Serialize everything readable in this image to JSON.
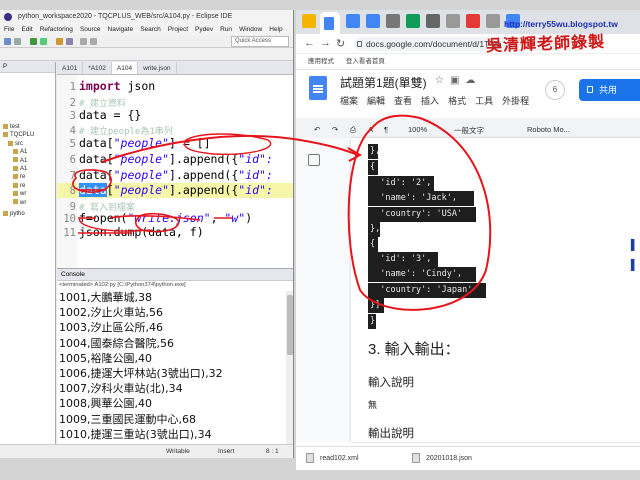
{
  "eclipse": {
    "window_title": "python_workspace2020 - TQCPLUS_WEB/src/A104.py - Eclipse IDE",
    "menu": [
      "File",
      "Edit",
      "Refactoring",
      "Source",
      "Navigate",
      "Search",
      "Project",
      "Pydev",
      "Run",
      "Window",
      "Help"
    ],
    "quick_access": "Quick Access",
    "package_explorer": {
      "tab_label": "P",
      "items": [
        "test",
        "TQCPLU",
        "src",
        "A1",
        "A1",
        "A1",
        "re",
        "re",
        "wr",
        "wr",
        "pytho"
      ]
    },
    "editor_tabs": [
      "A101",
      "*A102",
      "A104",
      "write.json"
    ],
    "code_lines": [
      {
        "n": "1",
        "segments": [
          {
            "t": "import",
            "c": "kw"
          },
          {
            "t": " json",
            "c": ""
          }
        ]
      },
      {
        "n": "2",
        "segments": [
          {
            "t": "# 建立資料",
            "c": "cmt"
          }
        ]
      },
      {
        "n": "3",
        "segments": [
          {
            "t": "data = {}",
            "c": ""
          }
        ]
      },
      {
        "n": "4",
        "segments": [
          {
            "t": "# 建立people為1串列",
            "c": "cmt"
          }
        ]
      },
      {
        "n": "5",
        "segments": [
          {
            "t": "data[",
            "c": ""
          },
          {
            "t": "\"people\"",
            "c": "str"
          },
          {
            "t": "] = []",
            "c": ""
          }
        ]
      },
      {
        "n": "6",
        "segments": [
          {
            "t": "data[",
            "c": ""
          },
          {
            "t": "\"people\"",
            "c": "str"
          },
          {
            "t": "].append({",
            "c": ""
          },
          {
            "t": "\"id\":",
            "c": "str"
          }
        ]
      },
      {
        "n": "7",
        "segments": [
          {
            "t": "data[",
            "c": ""
          },
          {
            "t": "\"people\"",
            "c": "str"
          },
          {
            "t": "].append({",
            "c": ""
          },
          {
            "t": "\"id\":",
            "c": "str"
          }
        ]
      },
      {
        "n": "8",
        "segments": [
          {
            "t": "data",
            "c": "sel"
          },
          {
            "t": "[",
            "c": ""
          },
          {
            "t": "\"people\"",
            "c": "str"
          },
          {
            "t": "].append({",
            "c": ""
          },
          {
            "t": "\"id\":",
            "c": "str"
          }
        ]
      },
      {
        "n": "9",
        "segments": [
          {
            "t": "# 寫入到檔案",
            "c": "cmt"
          }
        ]
      },
      {
        "n": "10",
        "segments": [
          {
            "t": "f=open(",
            "c": ""
          },
          {
            "t": "\"write.json\"",
            "c": "str"
          },
          {
            "t": ", ",
            "c": ""
          },
          {
            "t": "\"w\"",
            "c": "str"
          },
          {
            "t": ")",
            "c": ""
          }
        ]
      },
      {
        "n": "11",
        "segments": [
          {
            "t": "json.dump(data, f)",
            "c": ""
          }
        ]
      }
    ],
    "console": {
      "tab_label": "Console",
      "terminated": "<terminated> A102.py [C:\\Python374\\python.exe]",
      "lines": [
        "1001,大鵬華城,38",
        "1002,汐止火車站,56",
        "1003,汐止區公所,46",
        "1004,國泰綜合醫院,56",
        "1005,裕隆公園,40",
        "1006,捷運大坪林站(3號出口),32",
        "1007,汐科火車站(北),34",
        "1008,興華公園,40",
        "1009,三重國民運動中心,68",
        "1010,捷運三重站(3號出口),34"
      ]
    },
    "status": {
      "mode": "Writable",
      "insert": "Insert",
      "pos": "8 : 1"
    }
  },
  "chrome": {
    "url": "docs.google.com/document/d/1TYla",
    "bookmarks": [
      "應用程式",
      "登入看者首頁"
    ],
    "docs": {
      "title": "試題第1題(單雙)",
      "menu": [
        "檔案",
        "編輯",
        "查看",
        "插入",
        "格式",
        "工具",
        "外掛程"
      ],
      "avatar": "6",
      "share": "共用",
      "zoom": "100%",
      "style": "一般文字",
      "font": "Roboto Mo...",
      "json_lines": [
        "},",
        "{",
        "  'id': '2',",
        "  'name': 'Jack',",
        "  'country': 'USA'",
        "},",
        "{",
        "  'id': '3',",
        "  'name': 'Cindy',",
        "  'country': 'Japan'",
        "}]",
        "}"
      ],
      "heading": "3. 輸入輸出：",
      "input_desc": "輸入說明",
      "input_value": "無",
      "output_desc": "輸出說明"
    }
  },
  "downloads": [
    "read102.xml",
    "20201018.json"
  ],
  "watermark": {
    "url": "http://terry55wu.blogspot.tw",
    "name": "吳清輝老師錄製"
  },
  "colors": {
    "annotation_red": "#e8141c",
    "docs_blue": "#1a73e8",
    "selection_blue": "#3390ff"
  }
}
